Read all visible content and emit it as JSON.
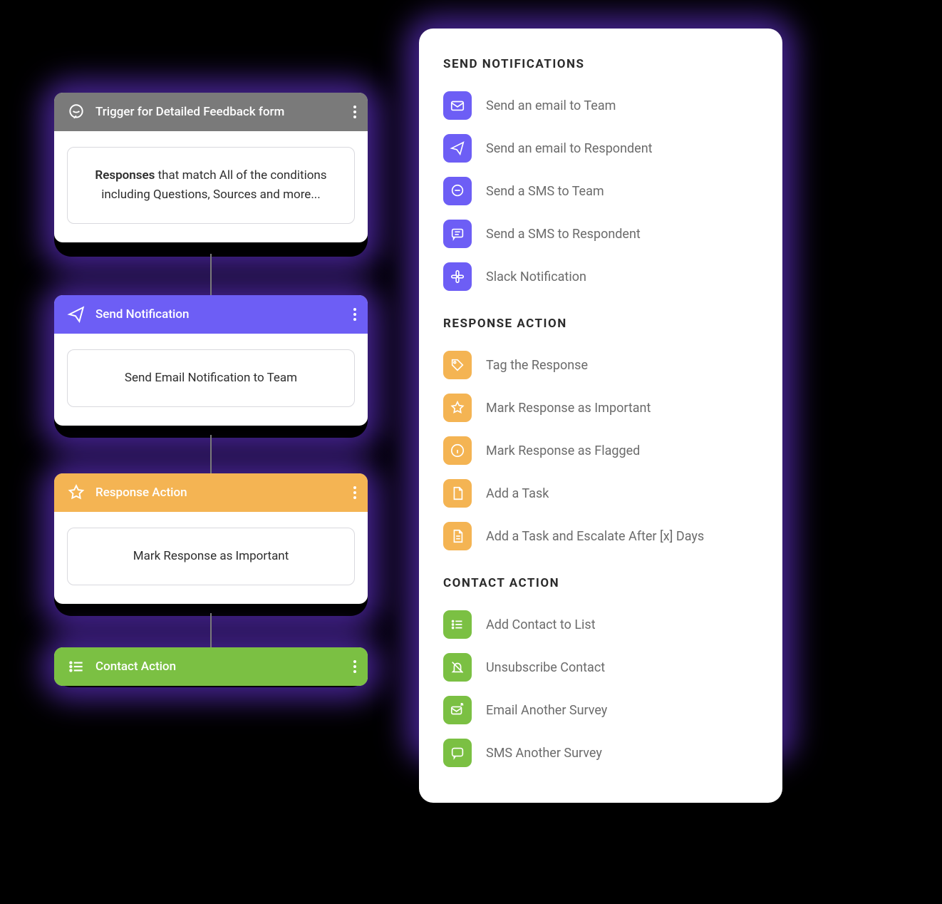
{
  "flow": {
    "trigger": {
      "title": "Trigger for Detailed Feedback form",
      "body_strong": "Responses",
      "body_rest": " that match All of the conditions including Questions, Sources and more..."
    },
    "notification": {
      "title": "Send Notification",
      "body": "Send Email Notification to Team"
    },
    "response": {
      "title": "Response Action",
      "body": "Mark Response as Important"
    },
    "contact": {
      "title": "Contact Action"
    }
  },
  "panel": {
    "sections": [
      {
        "title": "SEND NOTIFICATIONS",
        "items": [
          {
            "label": "Send an email to Team",
            "icon": "mail"
          },
          {
            "label": "Send an email to Respondent",
            "icon": "send"
          },
          {
            "label": "Send a SMS to Team",
            "icon": "chat"
          },
          {
            "label": "Send a SMS to Respondent",
            "icon": "sms"
          },
          {
            "label": "Slack Notification",
            "icon": "slack"
          }
        ],
        "color": "purple"
      },
      {
        "title": "RESPONSE ACTION",
        "items": [
          {
            "label": "Tag the Response",
            "icon": "tag"
          },
          {
            "label": "Mark Response as Important",
            "icon": "star"
          },
          {
            "label": "Mark Response as Flagged",
            "icon": "info"
          },
          {
            "label": "Add a Task",
            "icon": "file"
          },
          {
            "label": "Add a Task and Escalate After [x] Days",
            "icon": "file-lines"
          }
        ],
        "color": "orange"
      },
      {
        "title": "CONTACT ACTION",
        "items": [
          {
            "label": "Add Contact to List",
            "icon": "list"
          },
          {
            "label": "Unsubscribe Contact",
            "icon": "bell-off"
          },
          {
            "label": "Email Another Survey",
            "icon": "mail-out"
          },
          {
            "label": "SMS Another Survey",
            "icon": "message"
          }
        ],
        "color": "green"
      }
    ]
  }
}
